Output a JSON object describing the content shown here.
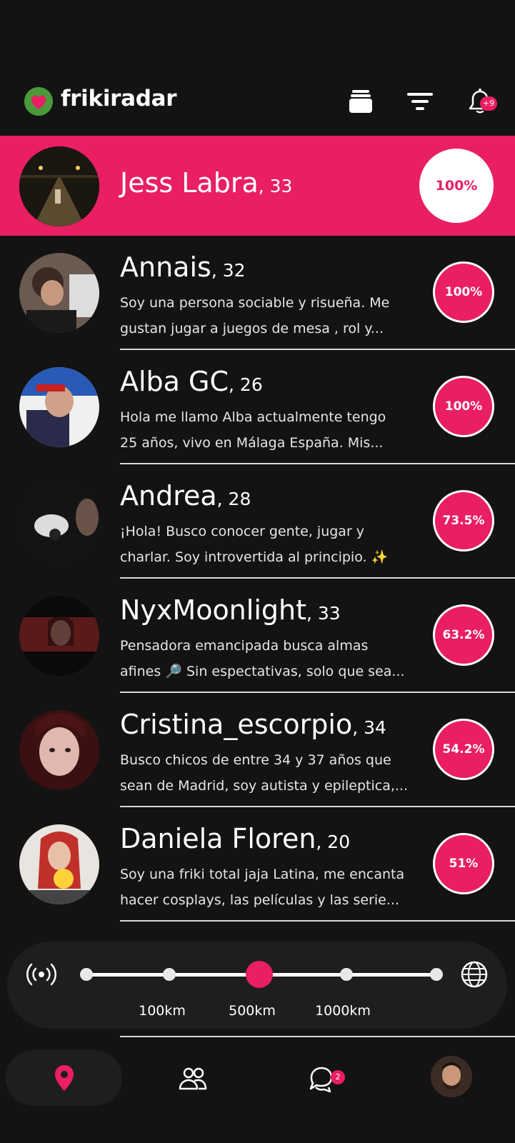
{
  "header": {
    "brand": "frikiradar",
    "notifications_badge": "+9"
  },
  "highlighted": {
    "name": "Jess Labra",
    "age": ", 33",
    "score": "100%"
  },
  "profiles": [
    {
      "name": "Annais",
      "age": ", 32",
      "bio_line1": "Soy una persona sociable y risueña. Me",
      "bio_line2": "gustan jugar a juegos de mesa , rol y...",
      "score": "100%"
    },
    {
      "name": "Alba GC",
      "age": ", 26",
      "bio_line1": "Hola me llamo Alba actualmente tengo",
      "bio_line2": "25 años, vivo en Málaga España. Mis...",
      "score": "100%"
    },
    {
      "name": "Andrea",
      "age": ", 28",
      "bio_line1": "¡Hola! Busco conocer gente, jugar y",
      "bio_line2": "charlar. Soy introvertida al principio. ✨",
      "score": "73.5%"
    },
    {
      "name": "NyxMoonlight",
      "age": ", 33",
      "bio_line1": "Pensadora emancipada busca almas",
      "bio_line2": "afines 🔎 Sin espectativas, solo que sea...",
      "score": "63.2%"
    },
    {
      "name": "Cristina_escorpio",
      "age": ", 34",
      "bio_line1": "Busco chicos de entre 34 y 37 años que",
      "bio_line2": "sean de Madrid, soy autista y epileptica,...",
      "score": "54.2%"
    },
    {
      "name": "Daniela Floren",
      "age": ", 20",
      "bio_line1": "Soy una friki total jaja Latina, me encanta",
      "bio_line2": "hacer cosplays, las películas y las serie...",
      "score": "51%"
    }
  ],
  "distance": {
    "labels": [
      "100km",
      "500km",
      "1000km"
    ],
    "selected": "500km"
  },
  "nav": {
    "chat_badge": "2"
  },
  "colors": {
    "accent": "#e91e63",
    "background": "#131313"
  },
  "icons": [
    "heart-logo-icon",
    "cards-icon",
    "filter-icon",
    "bell-icon",
    "radar-icon",
    "globe-icon",
    "location-pin-icon",
    "people-icon",
    "chat-icon"
  ]
}
